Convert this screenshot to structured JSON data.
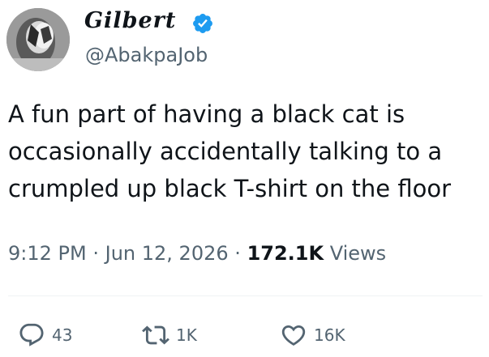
{
  "author": {
    "display_name": "Gilbert",
    "handle": "@AbakpaJob",
    "verified": true,
    "verified_color": "#1d9bf0"
  },
  "tweet": {
    "text_lines": [
      "A fun part of having a black cat is",
      "occasionally accidentally talking to a",
      "crumpled up black T-shirt on the floor"
    ],
    "time": "9:12 PM",
    "separator": "·",
    "date": "Jun 12, 2026",
    "views_count": "172.1K",
    "views_label": "Views"
  },
  "actions": {
    "reply": {
      "icon": "speech-bubble-icon",
      "count": "43"
    },
    "repost": {
      "icon": "repost-icon",
      "count": "1K"
    },
    "like": {
      "icon": "heart-icon",
      "count": "16K"
    }
  },
  "colors": {
    "text": "#0f1419",
    "secondary": "#536471",
    "accent": "#1d9bf0",
    "divider": "#eff3f4"
  }
}
